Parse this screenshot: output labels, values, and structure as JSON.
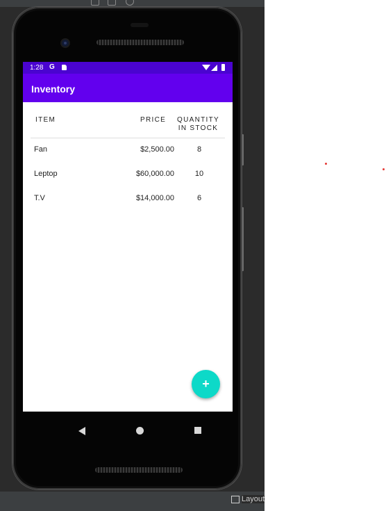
{
  "ide": {
    "bottom_tab_label": "Layout",
    "accent_color": "#6200ee",
    "fab_color": "#0dd9c8"
  },
  "status_bar": {
    "time": "1:28",
    "g_label": "G"
  },
  "app": {
    "title": "Inventory"
  },
  "table": {
    "headers": {
      "item": "ITEM",
      "price": "PRICE",
      "quantity_line1": "QUANTITY",
      "quantity_line2": "IN STOCK"
    },
    "rows": [
      {
        "item": "Fan",
        "price": "$2,500.00",
        "quantity": "8"
      },
      {
        "item": "Leptop",
        "price": "$60,000.00",
        "quantity": "10"
      },
      {
        "item": "T.V",
        "price": "$14,000.00",
        "quantity": "6"
      }
    ]
  },
  "fab": {
    "icon": "plus-icon",
    "symbol": "+"
  },
  "nav": {
    "back_icon": "back-triangle-icon",
    "home_icon": "home-circle-icon",
    "recents_icon": "recents-square-icon"
  }
}
